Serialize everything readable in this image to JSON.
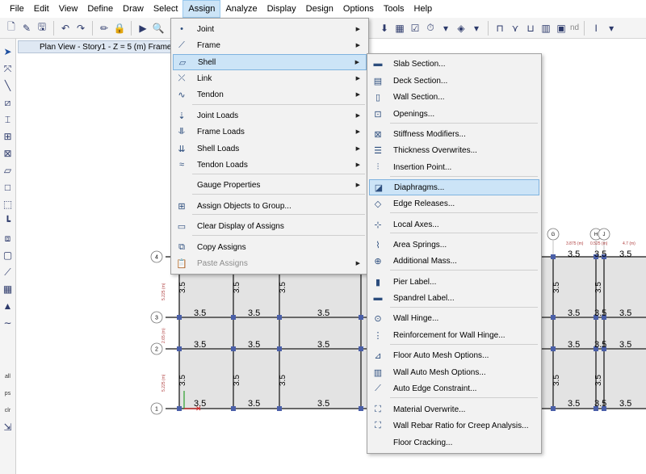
{
  "menubar": [
    "File",
    "Edit",
    "View",
    "Define",
    "Draw",
    "Select",
    "Assign",
    "Analyze",
    "Display",
    "Design",
    "Options",
    "Tools",
    "Help"
  ],
  "active_menu": "Assign",
  "toolbar": {
    "nd_label": "nd",
    "text_tool": "I"
  },
  "view_title": "Plan View - Story1 - Z = 5 (m)  Frame S",
  "assign_menu": {
    "items": [
      {
        "label": "Joint",
        "submenu": true,
        "icon": "joint-icon"
      },
      {
        "label": "Frame",
        "submenu": true,
        "icon": "frame-icon"
      },
      {
        "label": "Shell",
        "submenu": true,
        "icon": "shell-icon",
        "highlighted": true
      },
      {
        "label": "Link",
        "submenu": true,
        "icon": "link-icon"
      },
      {
        "label": "Tendon",
        "submenu": true,
        "icon": "tendon-icon"
      },
      {
        "label": "Joint Loads",
        "submenu": true,
        "icon": "joint-loads-icon"
      },
      {
        "label": "Frame Loads",
        "submenu": true,
        "icon": "frame-loads-icon"
      },
      {
        "label": "Shell Loads",
        "submenu": true,
        "icon": "shell-loads-icon"
      },
      {
        "label": "Tendon Loads",
        "submenu": true,
        "icon": "tendon-loads-icon"
      },
      {
        "label": "Gauge Properties",
        "submenu": true,
        "icon": ""
      },
      {
        "label": "Assign Objects to Group...",
        "submenu": false,
        "icon": "group-icon"
      },
      {
        "label": "Clear Display of Assigns",
        "submenu": false,
        "icon": "clear-display-icon"
      },
      {
        "label": "Copy Assigns",
        "submenu": false,
        "icon": "copy-icon"
      },
      {
        "label": "Paste Assigns",
        "submenu": true,
        "icon": "paste-icon",
        "disabled": true
      }
    ]
  },
  "shell_submenu": {
    "items": [
      {
        "label": "Slab Section...",
        "icon": "slab-icon"
      },
      {
        "label": "Deck Section...",
        "icon": "deck-icon"
      },
      {
        "label": "Wall Section...",
        "icon": "wall-icon"
      },
      {
        "label": "Openings...",
        "icon": "opening-icon"
      },
      {
        "label": "Stiffness Modifiers...",
        "icon": "stiffness-icon"
      },
      {
        "label": "Thickness Overwrites...",
        "icon": "thickness-icon"
      },
      {
        "label": "Insertion Point...",
        "icon": "insertion-icon"
      },
      {
        "label": "Diaphragms...",
        "icon": "diaphragm-icon",
        "highlighted": true
      },
      {
        "label": "Edge Releases...",
        "icon": "edge-release-icon"
      },
      {
        "label": "Local Axes...",
        "icon": "local-axes-icon"
      },
      {
        "label": "Area Springs...",
        "icon": "spring-icon"
      },
      {
        "label": "Additional Mass...",
        "icon": "mass-icon"
      },
      {
        "label": "Pier Label...",
        "icon": "pier-icon"
      },
      {
        "label": "Spandrel Label...",
        "icon": "spandrel-icon"
      },
      {
        "label": "Wall Hinge...",
        "icon": "hinge-icon"
      },
      {
        "label": "Reinforcement for Wall Hinge...",
        "icon": "reinforcement-icon"
      },
      {
        "label": "Floor Auto Mesh Options...",
        "icon": "floor-mesh-icon"
      },
      {
        "label": "Wall Auto Mesh Options...",
        "icon": "wall-mesh-icon"
      },
      {
        "label": "Auto Edge Constraint...",
        "icon": "edge-constraint-icon"
      },
      {
        "label": "Material Overwrite...",
        "icon": "material-icon"
      },
      {
        "label": "Wall Rebar Ratio for Creep Analysis...",
        "icon": "rebar-icon"
      },
      {
        "label": "Floor Cracking...",
        "icon": ""
      }
    ]
  },
  "plan": {
    "row_grid_labels": [
      "4",
      "3",
      "2",
      "1"
    ],
    "col_grid_labels": [
      "G",
      "H",
      "J"
    ],
    "row_dims": [
      "5.225 (m)",
      "2.65 (m)",
      "5.225 (m)"
    ],
    "col_dims": [
      "3.875 (m)",
      "0.525 (m)",
      "4.7 (m)"
    ],
    "shell_value": "3.5"
  },
  "colors": {
    "menu_highlight": "#cce4f7",
    "slab_fill": "#e3e3e3",
    "beam_line": "#3a3a3a",
    "column_marker": "#4a5fa8"
  }
}
